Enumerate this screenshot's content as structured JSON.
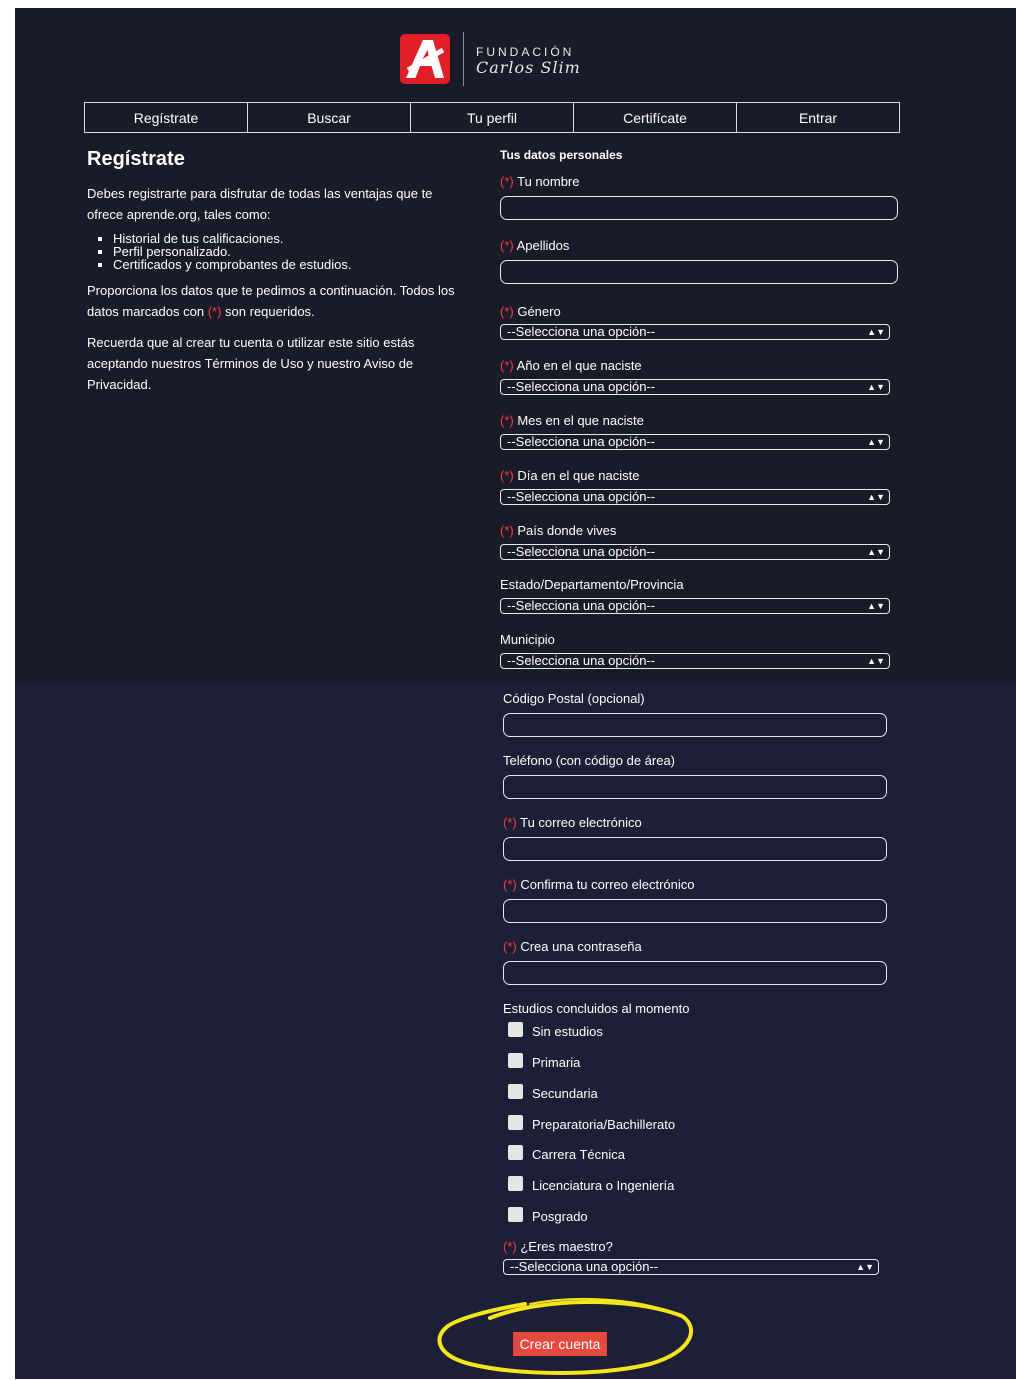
{
  "brand": {
    "logo_letter": "A",
    "line1": "FUNDACIÓN",
    "line2": "Carlos Slim",
    "logo_color": "#e11f26"
  },
  "nav": [
    {
      "label": "Regístrate"
    },
    {
      "label": "Buscar"
    },
    {
      "label": "Tu perfil"
    },
    {
      "label": "Certifícate"
    },
    {
      "label": "Entrar"
    }
  ],
  "intro": {
    "title": "Regístrate",
    "text1": "Debes registrarte para disfrutar de todas las ventajas que te ofrece aprende.org, tales como:",
    "benefits": [
      "Historial de tus calificaciones.",
      "Perfil personalizado.",
      "Certificados y comprobantes de estudios."
    ],
    "text2a": "Proporciona los datos que te pedimos a continuación. Todos los datos marcados con",
    "required_mark": "(*)",
    "text2b": "son requeridos.",
    "text3": "Recuerda que al crear tu cuenta o utilizar este sitio estás aceptando nuestros Términos de Uso y nuestro Aviso de Privacidad."
  },
  "form": {
    "section_title": "Tus datos personales",
    "required_mark": "(*)",
    "select_placeholder": "--Selecciona una opción--",
    "fields": {
      "nombre": "Tu nombre",
      "apellidos": "Apellidos",
      "genero": "Género",
      "anio": "Año en el que naciste",
      "mes": "Mes en el que naciste",
      "dia": "Día en el que naciste",
      "pais": "País donde vives",
      "estado": "Estado/Departamento/Provincia",
      "municipio": "Municipio",
      "cp": "Código Postal (opcional)",
      "telefono": "Teléfono (con código de área)",
      "correo": "Tu correo electrónico",
      "confirma_correo": "Confirma tu correo electrónico",
      "contrasena": "Crea una contraseña",
      "estudios": "Estudios concluidos al momento",
      "maestro": "¿Eres maestro?"
    },
    "estudios_options": [
      "Sin estudios",
      "Primaria",
      "Secundaria",
      "Preparatoria/Bachillerato",
      "Carrera Técnica",
      "Licenciatura o Ingeniería",
      "Posgrado"
    ],
    "submit_label": "Crear cuenta",
    "submit_color": "#e5493e"
  },
  "colors": {
    "background_top": "#1a1b28",
    "background_bottom": "#1c1f35",
    "required": "#ff3b3b",
    "highlight": "#f5e61a"
  }
}
